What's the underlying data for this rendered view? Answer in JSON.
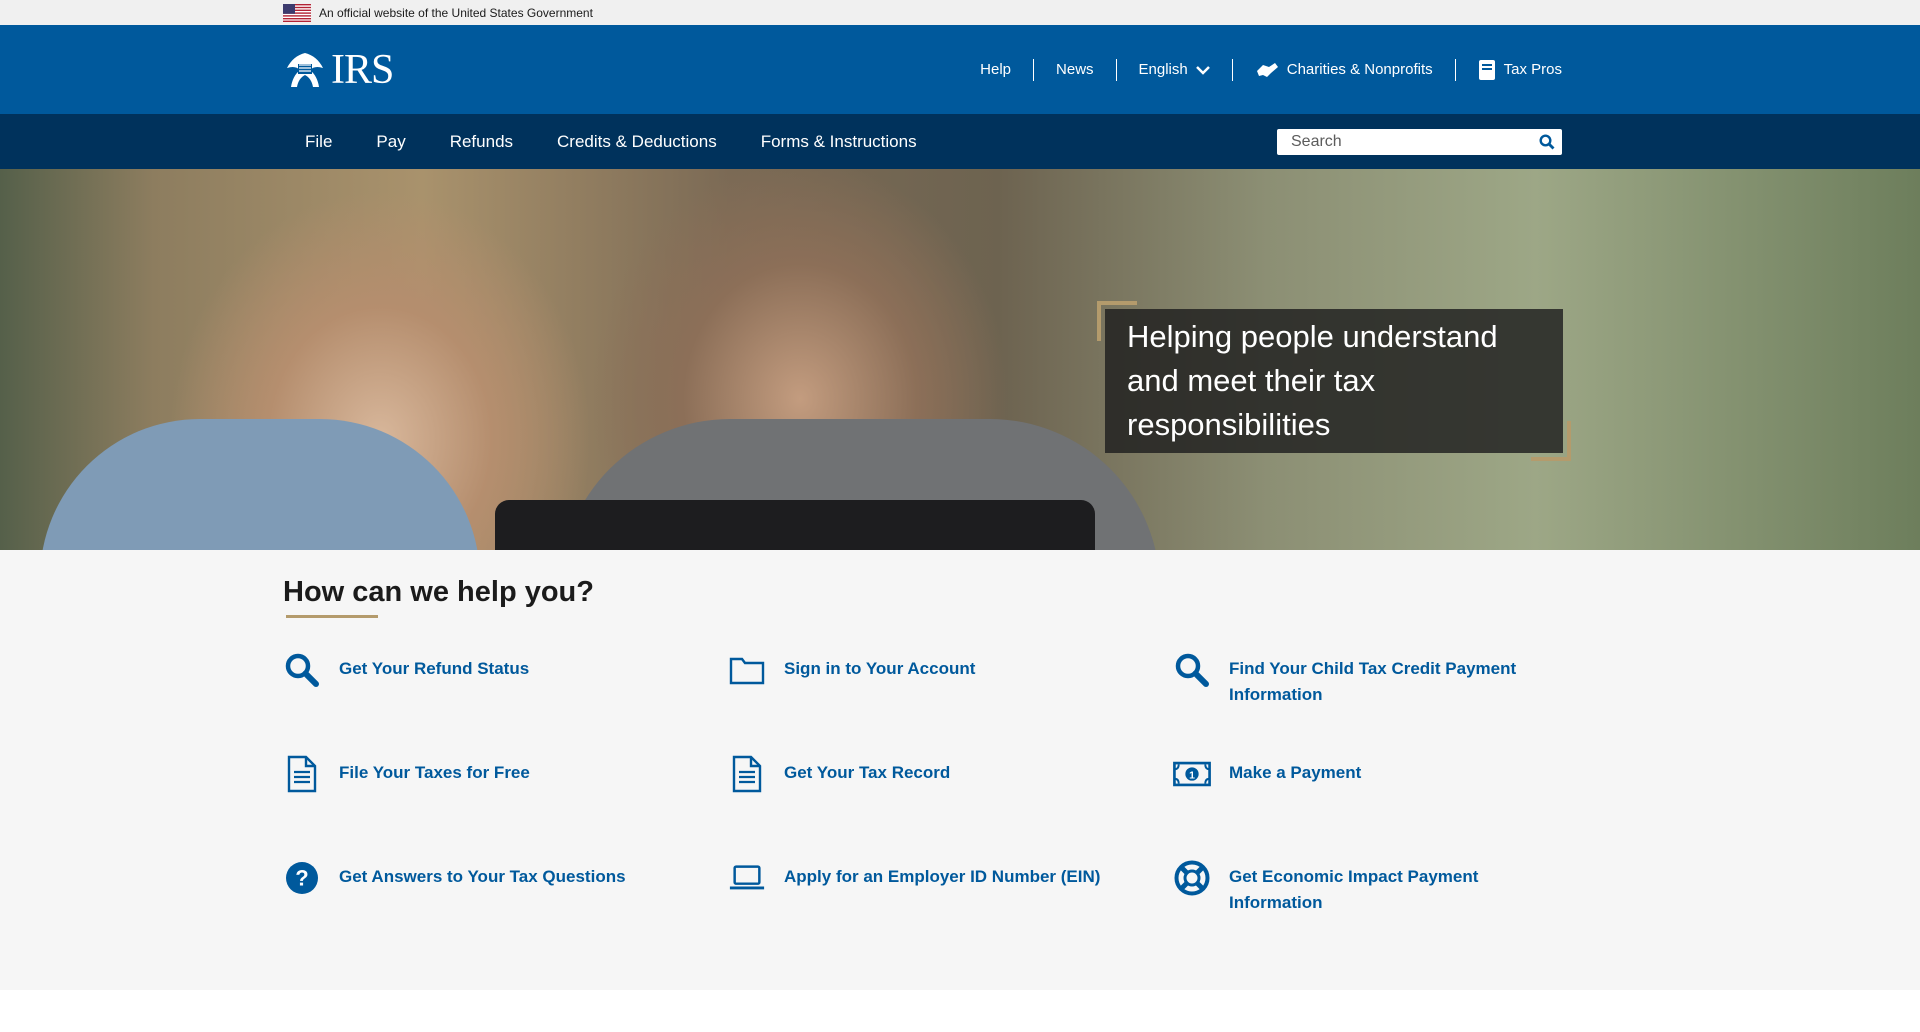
{
  "gov_banner": {
    "text": "An official website of the United States Government"
  },
  "header": {
    "logo_text": "IRS",
    "utility": {
      "help": "Help",
      "news": "News",
      "language": "English",
      "charities": "Charities & Nonprofits",
      "taxpros": "Tax Pros"
    }
  },
  "nav": {
    "items": [
      "File",
      "Pay",
      "Refunds",
      "Credits & Deductions",
      "Forms & Instructions"
    ],
    "search_placeholder": "Search"
  },
  "hero": {
    "quote": "Helping people understand and meet their tax responsibilities"
  },
  "help": {
    "heading": "How can we help you?",
    "links": [
      {
        "label": "Get Your Refund Status",
        "icon": "search-icon"
      },
      {
        "label": "Sign in to Your Account",
        "icon": "folder-icon"
      },
      {
        "label": "Find Your Child Tax Credit Payment Information",
        "icon": "search-icon"
      },
      {
        "label": "File Your Taxes for Free",
        "icon": "document-icon"
      },
      {
        "label": "Get Your Tax Record",
        "icon": "document-icon"
      },
      {
        "label": "Make a Payment",
        "icon": "money-icon"
      },
      {
        "label": "Get Answers to Your Tax Questions",
        "icon": "question-icon"
      },
      {
        "label": "Apply for an Employer ID Number (EIN)",
        "icon": "laptop-icon"
      },
      {
        "label": "Get Economic Impact Payment Information",
        "icon": "lifebuoy-icon"
      }
    ]
  },
  "colors": {
    "primary": "#00599c",
    "nav": "#00325c",
    "accent": "#b49b6c"
  }
}
